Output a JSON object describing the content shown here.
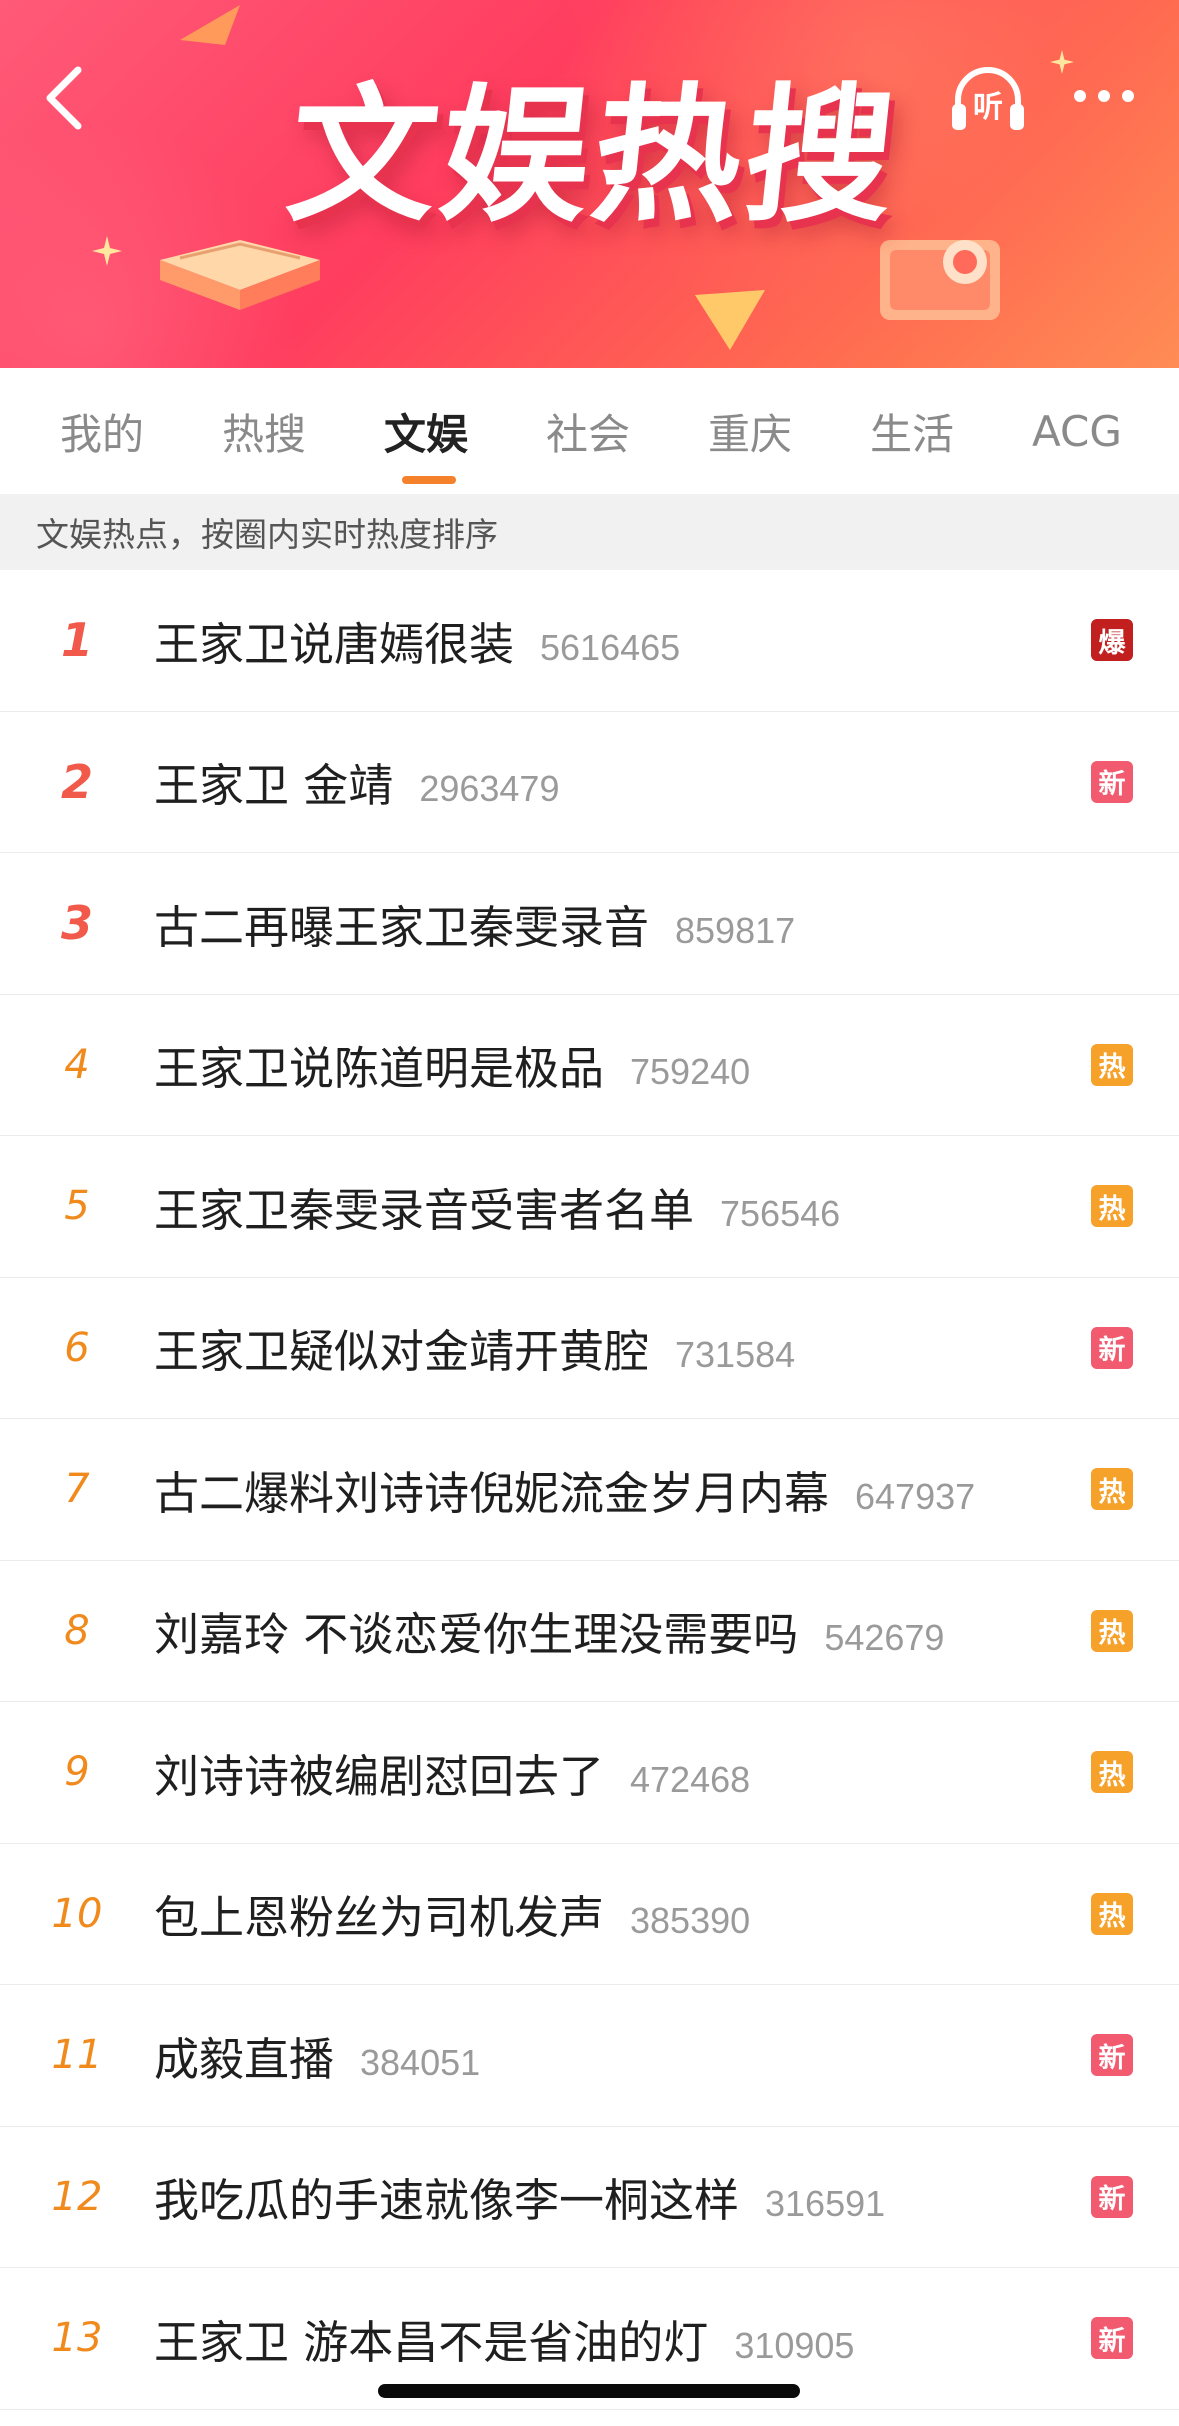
{
  "header": {
    "title": "文娱热搜",
    "listen_label": "听",
    "colors": {
      "banner_start": "#ff5a78",
      "banner_end": "#ff8c55"
    }
  },
  "tabs": [
    {
      "label": "我的",
      "active": false
    },
    {
      "label": "热搜",
      "active": false
    },
    {
      "label": "文娱",
      "active": true
    },
    {
      "label": "社会",
      "active": false
    },
    {
      "label": "重庆",
      "active": false
    },
    {
      "label": "生活",
      "active": false
    },
    {
      "label": "ACG",
      "active": false
    }
  ],
  "subheader": "文娱热点，按圈内实时热度排序",
  "badges": {
    "bao": {
      "label": "爆",
      "color": "#c21f1f"
    },
    "xin": {
      "label": "新",
      "color": "#f25a6f"
    },
    "re": {
      "label": "热",
      "color": "#f6a12a"
    }
  },
  "items": [
    {
      "rank": "1",
      "topic": "王家卫说唐嫣很装",
      "count": "5616465",
      "badge": "爆"
    },
    {
      "rank": "2",
      "topic": "王家卫 金靖",
      "count": "2963479",
      "badge": "新"
    },
    {
      "rank": "3",
      "topic": "古二再曝王家卫秦雯录音",
      "count": "859817",
      "badge": ""
    },
    {
      "rank": "4",
      "topic": "王家卫说陈道明是极品",
      "count": "759240",
      "badge": "热"
    },
    {
      "rank": "5",
      "topic": "王家卫秦雯录音受害者名单",
      "count": "756546",
      "badge": "热"
    },
    {
      "rank": "6",
      "topic": "王家卫疑似对金靖开黄腔",
      "count": "731584",
      "badge": "新"
    },
    {
      "rank": "7",
      "topic": "古二爆料刘诗诗倪妮流金岁月内幕",
      "count": "647937",
      "badge": "热"
    },
    {
      "rank": "8",
      "topic": "刘嘉玲 不谈恋爱你生理没需要吗",
      "count": "542679",
      "badge": "热"
    },
    {
      "rank": "9",
      "topic": "刘诗诗被编剧怼回去了",
      "count": "472468",
      "badge": "热"
    },
    {
      "rank": "10",
      "topic": "包上恩粉丝为司机发声",
      "count": "385390",
      "badge": "热"
    },
    {
      "rank": "11",
      "topic": "成毅直播",
      "count": "384051",
      "badge": "新"
    },
    {
      "rank": "12",
      "topic": "我吃瓜的手速就像李一桐这样",
      "count": "316591",
      "badge": "新"
    },
    {
      "rank": "13",
      "topic": "王家卫 游本昌不是省油的灯",
      "count": "310905",
      "badge": "新"
    }
  ]
}
